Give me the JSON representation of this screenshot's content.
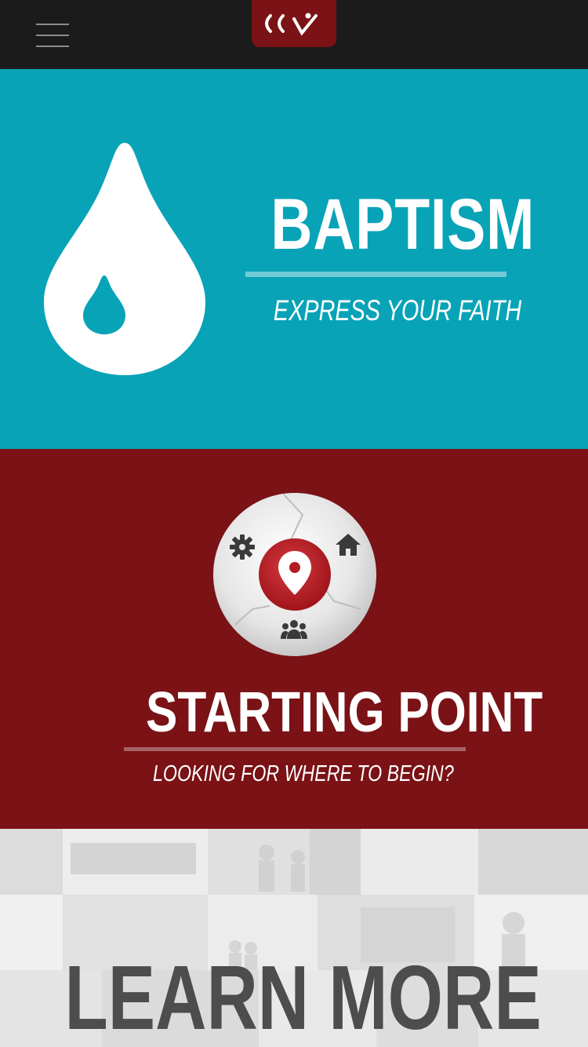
{
  "header": {
    "menu_icon": "hamburger-menu-icon",
    "logo_icon": "ccv-logo-icon",
    "logo_color": "#7a1216"
  },
  "baptism_card": {
    "title": "BAPTISM",
    "subtitle": "EXPRESS YOUR FAITH",
    "icon": "water-drop-icon",
    "bg_color": "#08a3b6"
  },
  "starting_point_card": {
    "title": "STARTING POINT",
    "subtitle": "LOOKING FOR WHERE TO BEGIN?",
    "icon": "location-pin-wheel-icon",
    "wheel_icons": [
      "gear-icon",
      "home-icon",
      "people-icon"
    ],
    "bg_color": "#7a1216"
  },
  "learn_more_card": {
    "title": "LEARN MORE",
    "background": "photo-collage"
  }
}
